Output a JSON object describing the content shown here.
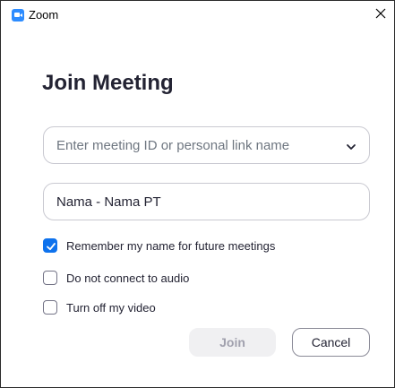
{
  "window": {
    "title": "Zoom"
  },
  "join": {
    "heading": "Join Meeting",
    "meeting_id_placeholder": "Enter meeting ID or personal link name",
    "name_value": "Nama - Nama PT",
    "options": [
      {
        "label": "Remember my name for future meetings",
        "checked": true
      },
      {
        "label": "Do not connect to audio",
        "checked": false
      },
      {
        "label": "Turn off my video",
        "checked": false
      }
    ],
    "join_label": "Join",
    "cancel_label": "Cancel"
  },
  "colors": {
    "accent": "#0e72ed",
    "zoom_blue": "#2d8cff",
    "disabled_button_bg": "#f0f0f2"
  },
  "icons": {
    "app": "zoom-logo-icon",
    "close": "close-icon",
    "dropdown": "chevron-down-icon",
    "check": "checkmark-icon"
  }
}
